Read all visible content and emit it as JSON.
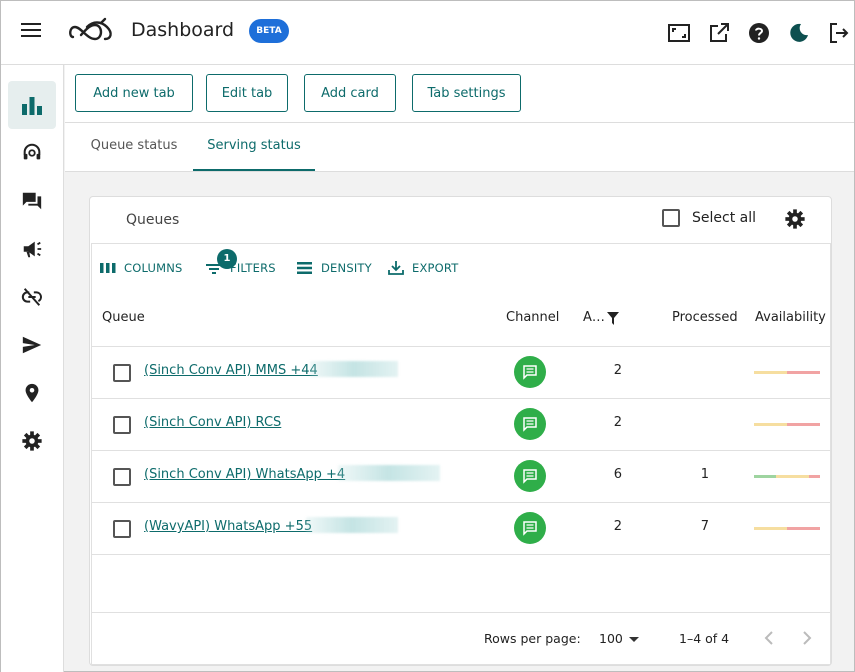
{
  "header": {
    "title": "Dashboard",
    "badge": "BETA",
    "icons": [
      "fullscreen-icon",
      "open-external-icon",
      "help-icon",
      "dark-mode-icon",
      "logout-icon"
    ]
  },
  "sidebar": {
    "items": [
      {
        "icon": "bar-chart-icon",
        "active": true
      },
      {
        "icon": "headset-icon",
        "active": false
      },
      {
        "icon": "chat-icon",
        "active": false
      },
      {
        "icon": "campaign-icon",
        "active": false
      },
      {
        "icon": "link-off-icon",
        "active": false
      },
      {
        "icon": "send-icon",
        "active": false
      },
      {
        "icon": "location-icon",
        "active": false
      },
      {
        "icon": "settings-icon",
        "active": false
      }
    ]
  },
  "toolbar": {
    "add_tab": "Add new tab",
    "edit_tab": "Edit tab",
    "add_card": "Add card",
    "tab_settings": "Tab settings"
  },
  "tabs": {
    "items": [
      {
        "label": "Queue status",
        "active": false
      },
      {
        "label": "Serving status",
        "active": true
      }
    ]
  },
  "card": {
    "title": "Queues",
    "select_all": "Select all",
    "grid": {
      "toolbar": {
        "columns": "COLUMNS",
        "filters": "FILTERS",
        "filter_count": "1",
        "density": "DENSITY",
        "export": "EXPORT"
      },
      "columns": {
        "queue": "Queue",
        "channel": "Channel",
        "a": "A…",
        "processed": "Processed",
        "availability": "Availability"
      },
      "rows": [
        {
          "queue": "(Sinch Conv API) MMS +44",
          "channel_icon": "chat-bubble-icon",
          "a": "2",
          "processed": "",
          "availability": [
            0.5,
            0.5
          ]
        },
        {
          "queue": "(Sinch Conv API) RCS",
          "channel_icon": "chat-bubble-icon",
          "a": "2",
          "processed": "",
          "availability": [
            0.5,
            0.5
          ]
        },
        {
          "queue": "(Sinch Conv API) WhatsApp +4",
          "channel_icon": "chat-bubble-icon",
          "a": "6",
          "processed": "1",
          "availability": [
            0.33,
            0.5,
            0.17
          ]
        },
        {
          "queue": "(WavyAPI) WhatsApp +55",
          "channel_icon": "chat-bubble-icon",
          "a": "2",
          "processed": "7",
          "availability": [
            0.5,
            0.5
          ]
        }
      ],
      "footer": {
        "rows_per_page_label": "Rows per page:",
        "rows_per_page": "100",
        "range": "1–4 of 4"
      }
    }
  },
  "colors": {
    "accent": "#0d6b6b",
    "beta": "#1e6fd9",
    "channel": "#2fae49",
    "avail_green": "#9ed4a0",
    "avail_yellow": "#f6dea0",
    "avail_red": "#f1a3a3"
  }
}
